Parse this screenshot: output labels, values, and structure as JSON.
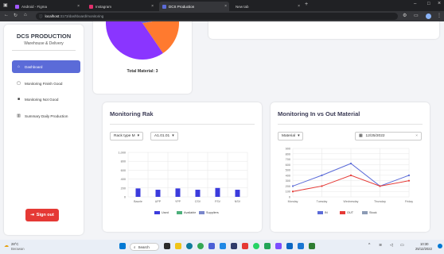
{
  "browser": {
    "tabs": [
      {
        "label": "Android - Figma",
        "active": false
      },
      {
        "label": "Instagram",
        "active": false
      },
      {
        "label": "DCS Production",
        "active": true
      },
      {
        "label": "New tab",
        "active": false
      }
    ],
    "url_host": "localhost",
    "url_path": ":3173/dashboard/monitoring"
  },
  "sidebar": {
    "title": "DCS PRODUCTION",
    "subtitle": "Warehouse & Delivery",
    "items": [
      {
        "label": "Dashboard",
        "icon": "home-icon",
        "active": true
      },
      {
        "label": "Monitoring Finish Good",
        "icon": "box-icon",
        "active": false
      },
      {
        "label": "Monitoring Not Good",
        "icon": "folder-icon",
        "active": false
      },
      {
        "label": "Summary Daily Production",
        "icon": "chart-icon",
        "active": false
      }
    ],
    "signout_label": "Sign out"
  },
  "pie_card": {
    "total_label": "Total Material: 3",
    "slices": [
      {
        "color": "#ff7a2f",
        "share": 0.18
      },
      {
        "color": "#8a35ff",
        "share": 0.49
      },
      {
        "color": "#5b6bd8",
        "share": 0.33
      }
    ]
  },
  "rak_card": {
    "title": "Monitoring Rak",
    "rack_type_label": "Rack type M",
    "location_label": "A1.01.01"
  },
  "inout_card": {
    "title": "Monitoring In vs Out Material",
    "material_label": "Material",
    "date_value": "12/25/2022"
  },
  "chart_data": [
    {
      "type": "bar",
      "categories": [
        "Bazzle",
        "UPP",
        "YPP",
        "CSV",
        "FSV",
        "NSV"
      ],
      "series": [
        {
          "name": "Used",
          "color": "#3b3bdc",
          "values": [
            190,
            160,
            190,
            160,
            200,
            160
          ]
        },
        {
          "name": "Available",
          "color": "#4caf7a",
          "values": [
            0,
            0,
            0,
            0,
            0,
            0
          ]
        },
        {
          "name": "Suppliers",
          "color": "#7986cb",
          "values": [
            0,
            0,
            0,
            0,
            0,
            0
          ]
        }
      ],
      "ylim": [
        0,
        1000
      ],
      "yticks": [
        "1,000",
        "800",
        "600",
        "400",
        "200",
        "0"
      ],
      "grid": true,
      "legend": "bottom"
    },
    {
      "type": "line",
      "categories": [
        "Monday",
        "Tuesday",
        "Wednesday",
        "Thursday",
        "Friday"
      ],
      "series": [
        {
          "name": "IN",
          "color": "#5b6bd8",
          "values": [
            200,
            400,
            620,
            200,
            400
          ]
        },
        {
          "name": "OUT",
          "color": "#e53935",
          "values": [
            100,
            200,
            400,
            200,
            300
          ]
        },
        {
          "name": "Stock",
          "color": "#8c9bb5",
          "values": []
        }
      ],
      "ylim": [
        0,
        900
      ],
      "yticks": [
        "900",
        "800",
        "700",
        "600",
        "500",
        "400",
        "300",
        "200",
        "100",
        "0"
      ],
      "grid": true,
      "legend": "bottom"
    }
  ],
  "taskbar": {
    "weather_temp": "28°C",
    "weather_desc": "Berawan",
    "search_label": "Search",
    "time": "10:30",
    "date": "25/12/2022"
  }
}
